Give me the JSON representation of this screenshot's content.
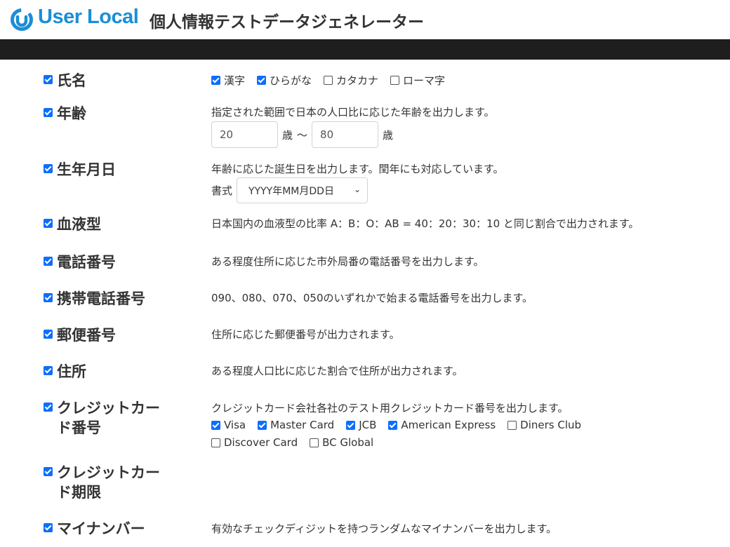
{
  "header": {
    "brand": "User Local",
    "title": "個人情報テストデータジェネレーター",
    "brand_color": "#1b8ed6"
  },
  "fields": {
    "name": {
      "label": "氏名",
      "checked": true,
      "options": [
        {
          "label": "漢字",
          "checked": true
        },
        {
          "label": "ひらがな",
          "checked": true
        },
        {
          "label": "カタカナ",
          "checked": false
        },
        {
          "label": "ローマ字",
          "checked": false
        }
      ]
    },
    "age": {
      "label": "年齢",
      "checked": true,
      "desc": "指定された範囲で日本の人口比に応じた年齢を出力します。",
      "min": "20",
      "max": "80",
      "unit": "歳",
      "separator": "〜"
    },
    "birthday": {
      "label": "生年月日",
      "checked": true,
      "desc": "年齢に応じた誕生日を出力します。閏年にも対応しています。",
      "format_label": "書式",
      "format_value": "YYYY年MM月DD日"
    },
    "blood": {
      "label": "血液型",
      "checked": true,
      "desc": "日本国内の血液型の比率 A：B：O：AB = 40：20：30：10 と同じ割合で出力されます。"
    },
    "phone": {
      "label": "電話番号",
      "checked": true,
      "desc": "ある程度住所に応じた市外局番の電話番号を出力します。"
    },
    "mobile": {
      "label": "携帯電話番号",
      "checked": true,
      "desc": "090、080、070、050のいずれかで始まる電話番号を出力します。"
    },
    "postal": {
      "label": "郵便番号",
      "checked": true,
      "desc": "住所に応じた郵便番号が出力されます。"
    },
    "address": {
      "label": "住所",
      "checked": true,
      "desc": "ある程度人口比に応じた割合で住所が出力されます。"
    },
    "card": {
      "label_line1": "クレジットカー",
      "label_line2": "ド番号",
      "checked": true,
      "desc": "クレジットカード会社各社のテスト用クレジットカード番号を出力します。",
      "options": [
        {
          "label": "Visa",
          "checked": true
        },
        {
          "label": "Master Card",
          "checked": true
        },
        {
          "label": "JCB",
          "checked": true
        },
        {
          "label": "American Express",
          "checked": true
        },
        {
          "label": "Diners Club",
          "checked": false
        },
        {
          "label": "Discover Card",
          "checked": false
        },
        {
          "label": "BC Global",
          "checked": false
        }
      ]
    },
    "card_expiry": {
      "label_line1": "クレジットカー",
      "label_line2": "ド期限",
      "checked": true
    },
    "mynumber": {
      "label": "マイナンバー",
      "checked": true,
      "desc": "有効なチェックディジットを持つランダムなマイナンバーを出力します。"
    }
  }
}
